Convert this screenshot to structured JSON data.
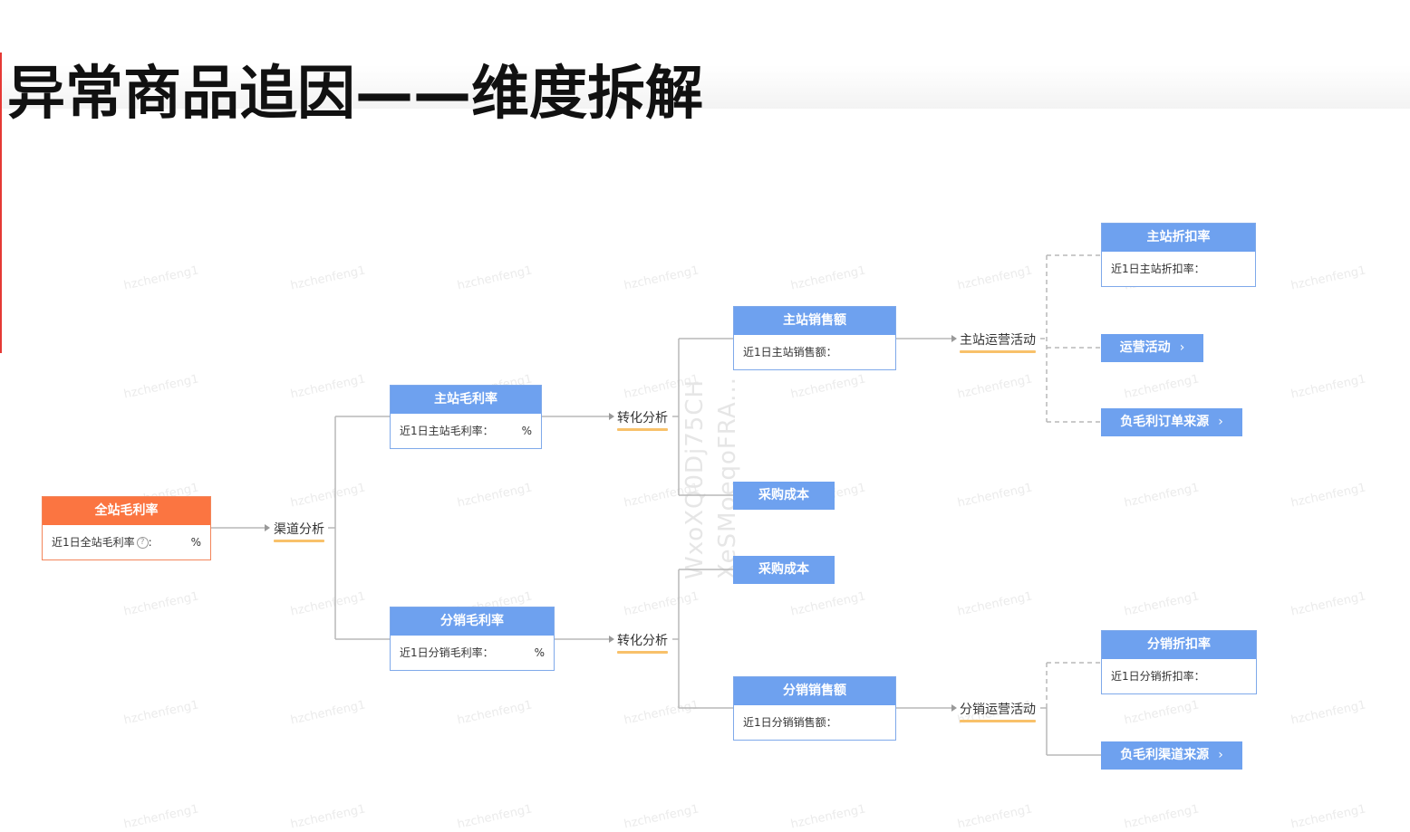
{
  "title": "异常商品追因——维度拆解",
  "watermark": {
    "repeat_text": "hzchenfeng1",
    "id_line1": "WxoXQ0Dj75CH",
    "id_line2": "XeSMoeqoFRA..."
  },
  "nodes": {
    "root": {
      "title": "全站毛利率",
      "label": "近1日全站毛利率",
      "help": "?",
      "unit": "%"
    },
    "main_margin": {
      "title": "主站毛利率",
      "label": "近1日主站毛利率：",
      "unit": "%"
    },
    "dist_margin": {
      "title": "分销毛利率",
      "label": "近1日分销毛利率：",
      "unit": "%"
    },
    "main_sales": {
      "title": "主站销售额",
      "label": "近1日主站销售额："
    },
    "dist_sales": {
      "title": "分销销售额",
      "label": "近1日分销销售额："
    },
    "main_discount": {
      "title": "主站折扣率",
      "label": "近1日主站折扣率："
    },
    "dist_discount": {
      "title": "分销折扣率",
      "label": "近1日分销折扣率："
    }
  },
  "buttons": {
    "purchase_cost_1": "采购成本",
    "purchase_cost_2": "采购成本",
    "ops_activity": "运营活动",
    "neg_margin_orders": "负毛利订单来源",
    "neg_margin_channels": "负毛利渠道来源",
    "chevron": "›"
  },
  "tags": {
    "channel_analysis": "渠道分析",
    "conversion_1": "转化分析",
    "conversion_2": "转化分析",
    "main_ops": "主站运营活动",
    "dist_ops": "分销运营活动"
  },
  "colors": {
    "root_header": "#fb7541",
    "node_header": "#6ea1ef",
    "tag_underline": "#f8c16a",
    "title_accent": "#e53935"
  }
}
